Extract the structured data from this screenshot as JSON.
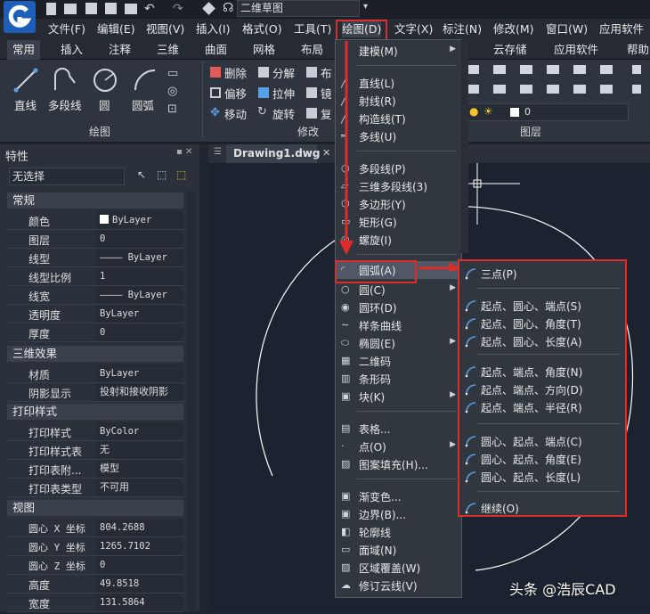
{
  "title_field": "二维草图",
  "menu": [
    "文件(F)",
    "编辑(E)",
    "视图(V)",
    "插入(I)",
    "格式(O)",
    "工具(T)",
    "绘图(D)",
    "文字(X)",
    "标注(N)",
    "修改(M)",
    "窗口(W)",
    "应用软件"
  ],
  "ribbon_tabs": [
    "常用",
    "插入",
    "注释",
    "三维",
    "曲面",
    "网格",
    "布局",
    "云存储",
    "应用软件",
    "帮助"
  ],
  "ribbon": {
    "draw_tools": [
      "直线",
      "多段线",
      "圆",
      "圆弧"
    ],
    "draw_panel": "绘图",
    "modify_tools": [
      "删除",
      "分解",
      "偏移",
      "拉伸",
      "移动",
      "旋转"
    ],
    "modify_tools_cut": [
      "布",
      "镜",
      "复"
    ],
    "modify_panel": "修改",
    "layer_panel": "图层",
    "layer_value": "0"
  },
  "properties": {
    "title": "特性",
    "selection": "无选择",
    "sections": [
      {
        "name": "常规",
        "rows": [
          [
            "颜色",
            "ByLayer"
          ],
          [
            "图层",
            "0"
          ],
          [
            "线型",
            "———— ByLayer"
          ],
          [
            "线型比例",
            "1"
          ],
          [
            "线宽",
            "———— ByLayer"
          ],
          [
            "透明度",
            "ByLayer"
          ],
          [
            "厚度",
            "0"
          ]
        ]
      },
      {
        "name": "三维效果",
        "rows": [
          [
            "材质",
            "ByLayer"
          ],
          [
            "阴影显示",
            "投射和接收阴影"
          ]
        ]
      },
      {
        "name": "打印样式",
        "rows": [
          [
            "打印样式",
            "ByColor"
          ],
          [
            "打印样式表",
            "无"
          ],
          [
            "打印表附...",
            "模型"
          ],
          [
            "打印表类型",
            "不可用"
          ]
        ]
      },
      {
        "name": "视图",
        "rows": [
          [
            "圆心 X 坐标",
            "804.2688"
          ],
          [
            "圆心 Y 坐标",
            "1265.7102"
          ],
          [
            "圆心 Z 坐标",
            "0"
          ],
          [
            "高度",
            "49.8518"
          ],
          [
            "宽度",
            "131.5864"
          ]
        ]
      }
    ]
  },
  "drawing_tab": "Drawing1.dwg",
  "draw_menu": [
    {
      "label": "建模(M)",
      "arrow": true
    },
    {
      "label": "直线(L)"
    },
    {
      "label": "射线(R)"
    },
    {
      "label": "构造线(T)"
    },
    {
      "label": "多线(U)"
    },
    {
      "label": "多段线(P)"
    },
    {
      "label": "三维多段线(3)"
    },
    {
      "label": "多边形(Y)"
    },
    {
      "label": "矩形(G)"
    },
    {
      "label": "螺旋(I)"
    },
    {
      "label": "圆弧(A)",
      "arrow": true
    },
    {
      "label": "圆(C)",
      "arrow": true
    },
    {
      "label": "圆环(D)"
    },
    {
      "label": "样条曲线"
    },
    {
      "label": "椭圆(E)",
      "arrow": true
    },
    {
      "label": "二维码"
    },
    {
      "label": "条形码"
    },
    {
      "label": "块(K)",
      "arrow": true
    },
    {
      "label": "表格..."
    },
    {
      "label": "点(O)",
      "arrow": true
    },
    {
      "label": "图案填充(H)..."
    },
    {
      "label": "渐变色..."
    },
    {
      "label": "边界(B)..."
    },
    {
      "label": "轮廓线"
    },
    {
      "label": "面域(N)"
    },
    {
      "label": "区域覆盖(W)"
    },
    {
      "label": "修订云线(V)"
    }
  ],
  "arc_submenu": [
    "三点(P)",
    "起点、圆心、端点(S)",
    "起点、圆心、角度(T)",
    "起点、圆心、长度(A)",
    "起点、端点、角度(N)",
    "起点、端点、方向(D)",
    "起点、端点、半径(R)",
    "圆心、起点、端点(C)",
    "圆心、起点、角度(E)",
    "圆心、起点、长度(L)",
    "继续(O)"
  ],
  "watermark": "头条 @浩辰CAD",
  "colors": {
    "accent_red": "#e02b2b",
    "menu_bg": "#31373f",
    "canvas_bg": "#1c2330"
  }
}
